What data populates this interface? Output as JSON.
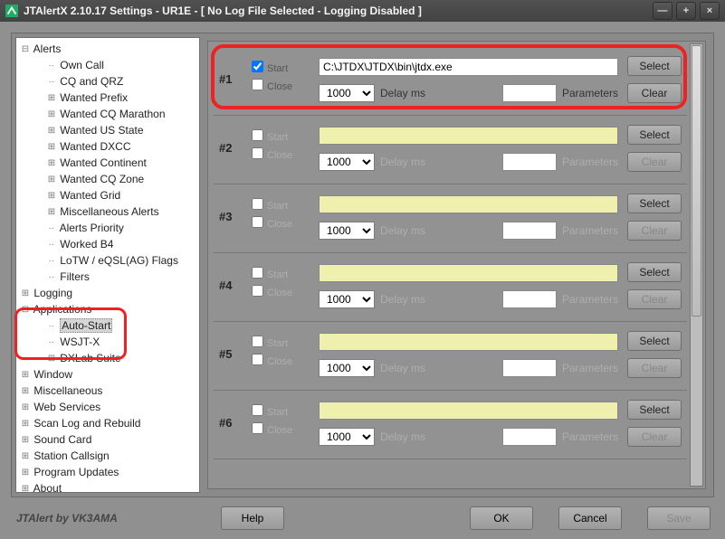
{
  "title": "JTAlertX 2.10.17 Settings   -   UR1E   -   [ No Log File Selected - Logging Disabled ]",
  "tree": {
    "alerts": {
      "label": "Alerts",
      "children": [
        "Own Call",
        "CQ and QRZ",
        "Wanted Prefix",
        "Wanted CQ Marathon",
        "Wanted US State",
        "Wanted DXCC",
        "Wanted Continent",
        "Wanted CQ Zone",
        "Wanted Grid",
        "Miscellaneous Alerts",
        "Alerts Priority",
        "Worked B4",
        "LoTW / eQSL(AG) Flags",
        "Filters"
      ]
    },
    "logging": {
      "label": "Logging"
    },
    "applications": {
      "label": "Applications",
      "children": [
        "Auto-Start",
        "WSJT-X",
        "DXLab Suite"
      ]
    },
    "rest": [
      "Window",
      "Miscellaneous",
      "Web Services",
      "Scan Log and Rebuild",
      "Sound Card",
      "Station Callsign",
      "Program Updates",
      "About"
    ]
  },
  "labels": {
    "start": "Start",
    "close": "Close",
    "delay": "Delay ms",
    "params": "Parameters",
    "select": "Select",
    "clear": "Clear",
    "help": "Help",
    "ok": "OK",
    "cancel": "Cancel",
    "save": "Save"
  },
  "rows": [
    {
      "num": "#1",
      "start": true,
      "close": false,
      "path": "C:\\JTDX\\JTDX\\bin\\jtdx.exe",
      "delay": "1000",
      "active": true
    },
    {
      "num": "#2",
      "start": false,
      "close": false,
      "path": "",
      "delay": "1000",
      "active": false
    },
    {
      "num": "#3",
      "start": false,
      "close": false,
      "path": "",
      "delay": "1000",
      "active": false
    },
    {
      "num": "#4",
      "start": false,
      "close": false,
      "path": "",
      "delay": "1000",
      "active": false
    },
    {
      "num": "#5",
      "start": false,
      "close": false,
      "path": "",
      "delay": "1000",
      "active": false
    },
    {
      "num": "#6",
      "start": false,
      "close": false,
      "path": "",
      "delay": "1000",
      "active": false
    }
  ],
  "credit": "JTAlert by VK3AMA"
}
